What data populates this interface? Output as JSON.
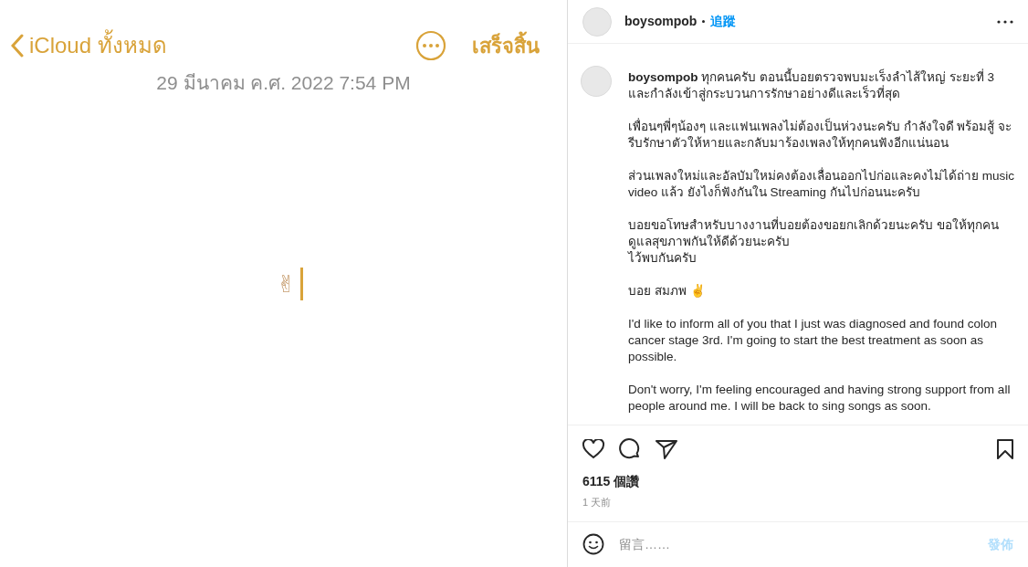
{
  "note": {
    "back_label": "iCloud ทั้งหมด",
    "done_label": "เสร็จสิ้น",
    "date": "29 มีนาคม ค.ศ. 2022 7:54 PM",
    "body": "✌"
  },
  "post": {
    "username": "boysompob",
    "follow_label": "追蹤",
    "caption": {
      "username": "boysompob",
      "paragraphs": [
        "ทุกคนครับ ตอนนี้บอยตรวจพบมะเร็งลำไส้ใหญ่ ระยะที่ 3 และกำลังเข้าสู่กระบวนการรักษาอย่างดีและเร็วที่สุด",
        "เพื่อนๆพี่ๆน้องๆ และแฟนเพลงไม่ต้องเป็นห่วงนะครับ กำลังใจดี พร้อมสู้ จะรีบรักษาตัวให้หายและกลับมาร้องเพลงให้ทุกคนฟังอีกแน่นอน",
        "ส่วนเพลงใหม่และอัลบัมใหม่คงต้องเลื่อนออกไปก่อและคงไม่ได้ถ่าย music video แล้ว ยังไงก็ฟังกันใน Streaming กันไปก่อนนะครับ",
        "บอยขอโทษสำหรับบางงานที่บอยต้องขอยกเลิกด้วยนะครับ ขอให้ทุกคน\nดูแลสุขภาพกันให้ดีด้วยนะครับ\nไว้พบกันครับ",
        "บอย สมภพ ✌",
        "I'd like to inform all of you that I just was diagnosed and found colon cancer stage 3rd. I'm going to start the best treatment as soon as possible.",
        "Don't worry, I'm feeling encouraged and having strong support from all people around me. I will be back to sing songs as soon."
      ]
    },
    "likes": "6115 個讚",
    "time": "1 天前",
    "comment_placeholder": "留言……",
    "post_label": "發佈"
  }
}
